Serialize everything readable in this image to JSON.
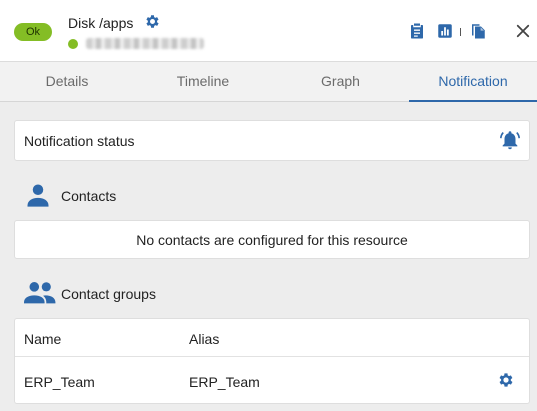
{
  "header": {
    "status": "Ok",
    "title": "Disk /apps",
    "host_blurred": "redacted host name",
    "icons": [
      "gear-icon",
      "clipboard-icon",
      "bar-chart-icon",
      "copy-icon",
      "close-icon"
    ]
  },
  "tabs": [
    {
      "label": "Details",
      "active": false
    },
    {
      "label": "Timeline",
      "active": false
    },
    {
      "label": "Graph",
      "active": false
    },
    {
      "label": "Notification",
      "active": true
    }
  ],
  "notification": {
    "status_label": "Notification status",
    "icon": "bell-ringing-icon"
  },
  "contacts": {
    "label": "Contacts",
    "empty_message": "No contacts are configured for this resource"
  },
  "contact_groups": {
    "label": "Contact groups",
    "columns": [
      "Name",
      "Alias"
    ],
    "rows": [
      {
        "name": "ERP_Team",
        "alias": "ERP_Team"
      }
    ]
  },
  "colors": {
    "accent": "#2e68aa",
    "ok": "#84bd25"
  }
}
